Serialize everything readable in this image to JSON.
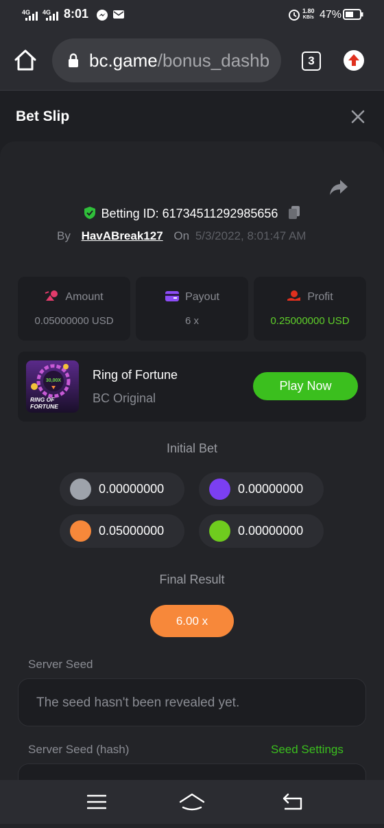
{
  "status_bar": {
    "time": "8:01",
    "network1": "4G",
    "network2": "4G",
    "speed_value": "1.80",
    "speed_unit": "KB/s",
    "battery": "47%"
  },
  "browser": {
    "url_host": "bc.game",
    "url_path": "/bonus_dashb",
    "tab_count": "3"
  },
  "header": {
    "title": "Bet Slip"
  },
  "bet": {
    "betting_id_label": "Betting ID: 617345112929856​56",
    "by_label": "By",
    "user": "HavABreak127",
    "on_label": "On",
    "datetime": "5/3/2022, 8:01:47 AM"
  },
  "stats": [
    {
      "label": "Amount",
      "value": "0.05000000 USD",
      "icon": "amount-icon"
    },
    {
      "label": "Payout",
      "value": "6 x",
      "icon": "wallet-icon"
    },
    {
      "label": "Profit",
      "value": "0.25000000 USD",
      "icon": "profit-icon"
    }
  ],
  "game": {
    "name": "Ring of Fortune",
    "subtitle": "BC Original",
    "play_label": "Play Now",
    "thumb_big": "30,00X",
    "thumb_line1": "RING OF",
    "thumb_line2": "FORTUNE"
  },
  "initial_bet": {
    "title": "Initial Bet",
    "chips": [
      {
        "color": "#9ea3ab",
        "value": "0.00000000"
      },
      {
        "color": "#7b3ff2",
        "value": "0.00000000"
      },
      {
        "color": "#f7883a",
        "value": "0.05000000"
      },
      {
        "color": "#6fcb1e",
        "value": "0.00000000"
      }
    ]
  },
  "final_result": {
    "title": "Final Result",
    "value": "6.00 x"
  },
  "server_seed": {
    "label": "Server Seed",
    "value": "The seed hasn't been revealed yet.",
    "hash_label": "Server Seed (hash)",
    "settings_link": "Seed Settings"
  },
  "colors": {
    "accent_green": "#3bbf1e",
    "profit_green": "#5fcf2a",
    "orange": "#f7883a",
    "shield_green": "#2fbf3a"
  }
}
